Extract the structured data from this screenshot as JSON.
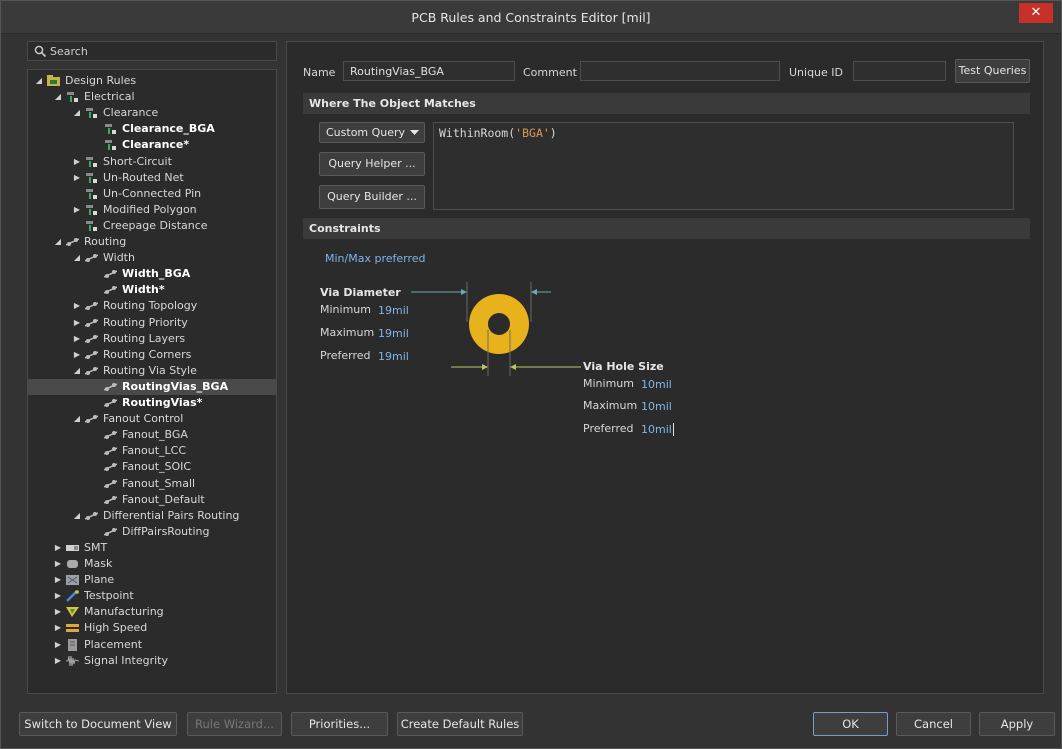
{
  "window": {
    "title": "PCB Rules and Constraints Editor [mil]",
    "close_glyph": "✕"
  },
  "search": {
    "placeholder": "Search"
  },
  "tree": [
    {
      "label": "Design Rules",
      "level": 0,
      "arrow": "expanded",
      "icon": "folder-icon",
      "bold": false
    },
    {
      "label": "Electrical",
      "level": 1,
      "arrow": "expanded",
      "icon": "rule-icon",
      "bold": false
    },
    {
      "label": "Clearance",
      "level": 2,
      "arrow": "expanded",
      "icon": "rule-icon",
      "bold": false
    },
    {
      "label": "Clearance_BGA",
      "level": 3,
      "arrow": "none",
      "icon": "rule-icon",
      "bold": true
    },
    {
      "label": "Clearance*",
      "level": 3,
      "arrow": "none",
      "icon": "rule-icon",
      "bold": true
    },
    {
      "label": "Short-Circuit",
      "level": 2,
      "arrow": "collapsed",
      "icon": "rule-icon",
      "bold": false
    },
    {
      "label": "Un-Routed Net",
      "level": 2,
      "arrow": "collapsed",
      "icon": "rule-icon",
      "bold": false
    },
    {
      "label": "Un-Connected Pin",
      "level": 2,
      "arrow": "none",
      "icon": "rule-icon",
      "bold": false
    },
    {
      "label": "Modified Polygon",
      "level": 2,
      "arrow": "collapsed",
      "icon": "rule-icon",
      "bold": false
    },
    {
      "label": "Creepage Distance",
      "level": 2,
      "arrow": "none",
      "icon": "rule-icon",
      "bold": false
    },
    {
      "label": "Routing",
      "level": 1,
      "arrow": "expanded",
      "icon": "routing-icon",
      "bold": false
    },
    {
      "label": "Width",
      "level": 2,
      "arrow": "expanded",
      "icon": "routing-icon",
      "bold": false
    },
    {
      "label": "Width_BGA",
      "level": 3,
      "arrow": "none",
      "icon": "routing-icon",
      "bold": true
    },
    {
      "label": "Width*",
      "level": 3,
      "arrow": "none",
      "icon": "routing-icon",
      "bold": true
    },
    {
      "label": "Routing Topology",
      "level": 2,
      "arrow": "collapsed",
      "icon": "routing-icon",
      "bold": false
    },
    {
      "label": "Routing Priority",
      "level": 2,
      "arrow": "collapsed",
      "icon": "routing-icon",
      "bold": false
    },
    {
      "label": "Routing Layers",
      "level": 2,
      "arrow": "collapsed",
      "icon": "routing-icon",
      "bold": false
    },
    {
      "label": "Routing Corners",
      "level": 2,
      "arrow": "collapsed",
      "icon": "routing-icon",
      "bold": false
    },
    {
      "label": "Routing Via Style",
      "level": 2,
      "arrow": "expanded",
      "icon": "routing-icon",
      "bold": false
    },
    {
      "label": "RoutingVias_BGA",
      "level": 3,
      "arrow": "none",
      "icon": "routing-icon",
      "bold": true,
      "selected": true
    },
    {
      "label": "RoutingVias*",
      "level": 3,
      "arrow": "none",
      "icon": "routing-icon",
      "bold": true
    },
    {
      "label": "Fanout Control",
      "level": 2,
      "arrow": "expanded",
      "icon": "routing-icon",
      "bold": false
    },
    {
      "label": "Fanout_BGA",
      "level": 3,
      "arrow": "none",
      "icon": "routing-icon",
      "bold": false
    },
    {
      "label": "Fanout_LCC",
      "level": 3,
      "arrow": "none",
      "icon": "routing-icon",
      "bold": false
    },
    {
      "label": "Fanout_SOIC",
      "level": 3,
      "arrow": "none",
      "icon": "routing-icon",
      "bold": false
    },
    {
      "label": "Fanout_Small",
      "level": 3,
      "arrow": "none",
      "icon": "routing-icon",
      "bold": false
    },
    {
      "label": "Fanout_Default",
      "level": 3,
      "arrow": "none",
      "icon": "routing-icon",
      "bold": false
    },
    {
      "label": "Differential Pairs Routing",
      "level": 2,
      "arrow": "expanded",
      "icon": "routing-icon",
      "bold": false
    },
    {
      "label": "DiffPairsRouting",
      "level": 3,
      "arrow": "none",
      "icon": "routing-icon",
      "bold": false
    },
    {
      "label": "SMT",
      "level": 1,
      "arrow": "collapsed",
      "icon": "smt-icon",
      "bold": false
    },
    {
      "label": "Mask",
      "level": 1,
      "arrow": "collapsed",
      "icon": "mask-icon",
      "bold": false
    },
    {
      "label": "Plane",
      "level": 1,
      "arrow": "collapsed",
      "icon": "plane-icon",
      "bold": false
    },
    {
      "label": "Testpoint",
      "level": 1,
      "arrow": "collapsed",
      "icon": "testpoint-icon",
      "bold": false
    },
    {
      "label": "Manufacturing",
      "level": 1,
      "arrow": "collapsed",
      "icon": "manufacturing-icon",
      "bold": false
    },
    {
      "label": "High Speed",
      "level": 1,
      "arrow": "collapsed",
      "icon": "high-speed-icon",
      "bold": false
    },
    {
      "label": "Placement",
      "level": 1,
      "arrow": "collapsed",
      "icon": "placement-icon",
      "bold": false
    },
    {
      "label": "Signal Integrity",
      "level": 1,
      "arrow": "collapsed",
      "icon": "signal-integrity-icon",
      "bold": false
    }
  ],
  "rule": {
    "name_label": "Name",
    "name_value": "RoutingVias_BGA",
    "comment_label": "Comment",
    "comment_value": "",
    "unique_id_label": "Unique ID",
    "unique_id_value": "",
    "test_queries_label": "Test Queries"
  },
  "where": {
    "header": "Where The Object Matches",
    "query_type": "Custom Query",
    "query_helper_label": "Query Helper ...",
    "query_builder_label": "Query Builder ...",
    "query_fn": "WithinRoom(",
    "query_arg": "'BGA'",
    "query_close": ")"
  },
  "constraints": {
    "header": "Constraints",
    "mode_link": "Min/Max preferred",
    "via_diameter": {
      "title": "Via Diameter",
      "minimum_label": "Minimum",
      "minimum_value": "19mil",
      "maximum_label": "Maximum",
      "maximum_value": "19mil",
      "preferred_label": "Preferred",
      "preferred_value": "19mil"
    },
    "via_hole": {
      "title": "Via Hole Size",
      "minimum_label": "Minimum",
      "minimum_value": "10mil",
      "maximum_label": "Maximum",
      "maximum_value": "10mil",
      "preferred_label": "Preferred",
      "preferred_value": "10mil"
    }
  },
  "buttons": {
    "switch_view": "Switch to Document View",
    "rule_wizard": "Rule Wizard...",
    "priorities": "Priorities...",
    "create_default": "Create Default Rules",
    "ok": "OK",
    "cancel": "Cancel",
    "apply": "Apply"
  },
  "colors": {
    "via_copper": "#e8b21c",
    "accent_link": "#7fb5ea",
    "close_red": "#c8302a"
  }
}
